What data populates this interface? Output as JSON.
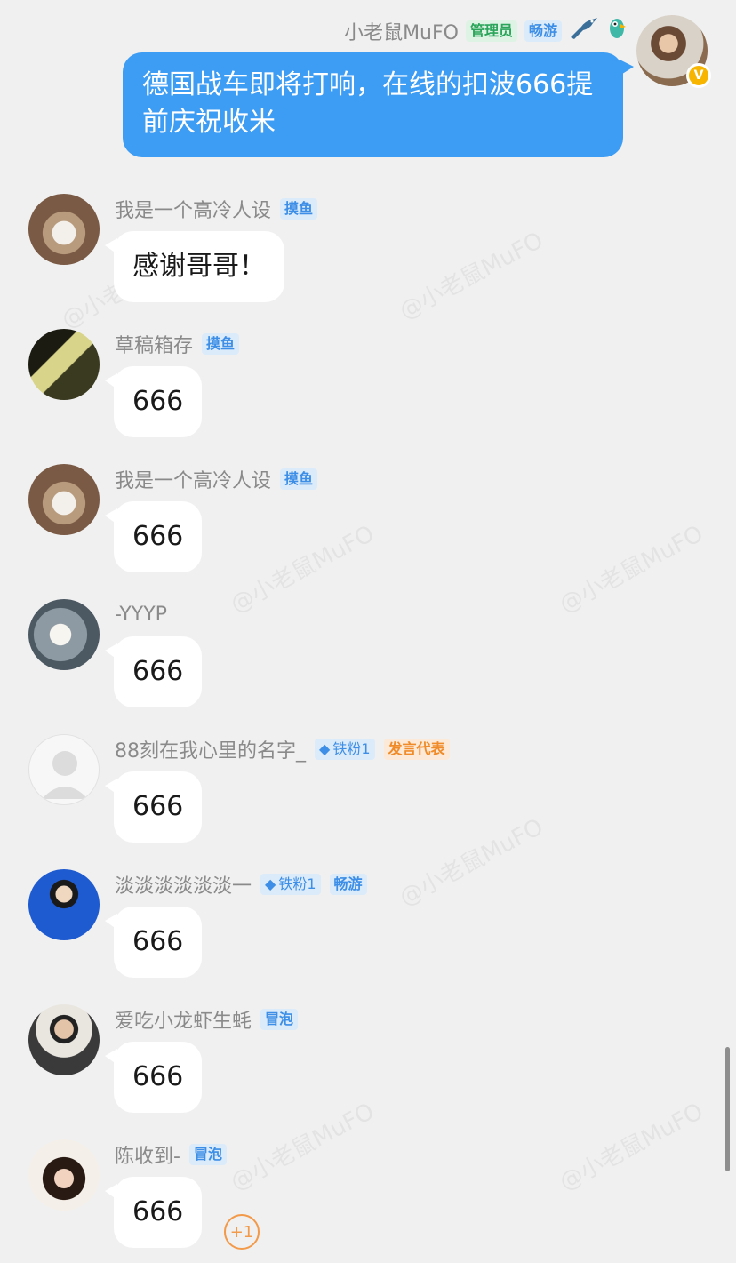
{
  "watermark_text": "@小老鼠MuFO",
  "self_message": {
    "name": "小老鼠MuFO",
    "tags": [
      "管理员",
      "畅游"
    ],
    "text": "德国战车即将打响，在线的扣波666提前庆祝收米",
    "badge": "V"
  },
  "messages": [
    {
      "name": "我是一个高冷人设",
      "tags": [
        {
          "text": "摸鱼",
          "style": "blue"
        }
      ],
      "text": "感谢哥哥！"
    },
    {
      "name": "草稿箱存",
      "tags": [
        {
          "text": "摸鱼",
          "style": "blue"
        }
      ],
      "text": "666"
    },
    {
      "name": "我是一个高冷人设",
      "tags": [
        {
          "text": "摸鱼",
          "style": "blue"
        }
      ],
      "text": "666"
    },
    {
      "name": "-YYYP",
      "tags": [],
      "text": "666"
    },
    {
      "name": "88刻在我心里的名字_",
      "tags": [
        {
          "text": "铁粉1",
          "style": "fan"
        },
        {
          "text": "发言代表",
          "style": "orange"
        }
      ],
      "text": "666"
    },
    {
      "name": "淡淡淡淡淡淡一",
      "tags": [
        {
          "text": "铁粉1",
          "style": "fan"
        },
        {
          "text": "畅游",
          "style": "blue"
        }
      ],
      "text": "666"
    },
    {
      "name": "爱吃小龙虾生蚝",
      "tags": [
        {
          "text": "冒泡",
          "style": "blue"
        }
      ],
      "text": "666"
    },
    {
      "name": "陈收到-",
      "tags": [
        {
          "text": "冒泡",
          "style": "blue"
        }
      ],
      "text": "666"
    }
  ],
  "plus_one": "+1",
  "colors": {
    "background": "#f0f0f0",
    "self_bubble": "#3d9cf3",
    "other_bubble": "#ffffff",
    "name_text": "#8a8a8a",
    "accent_orange": "#f29a49"
  }
}
